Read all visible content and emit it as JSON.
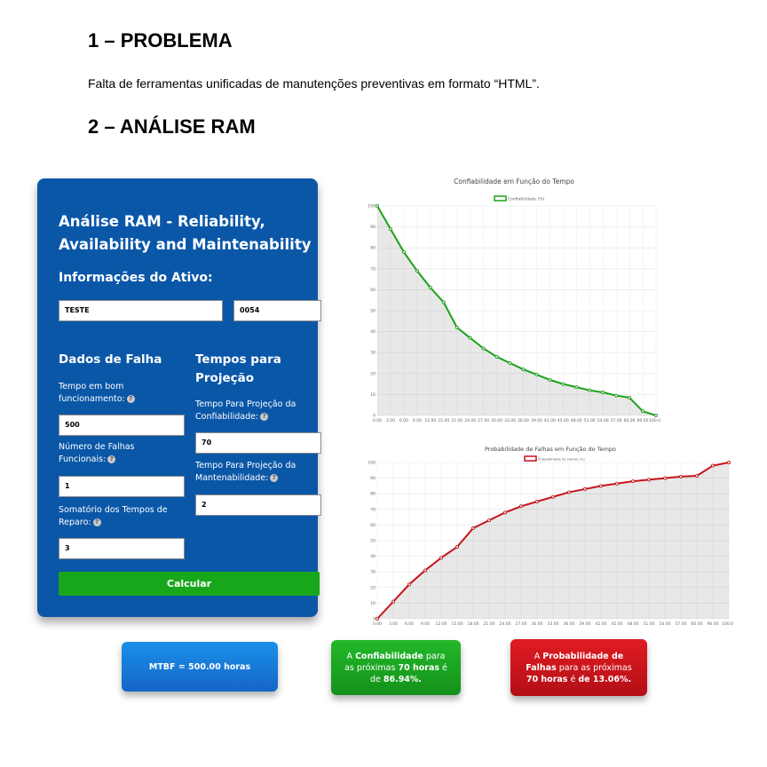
{
  "section1": {
    "heading": "1 – PROBLEMA",
    "text": "Falta de ferramentas unificadas de manutenções preventivas em formato “HTML”."
  },
  "section2": {
    "heading": "2 – ANÁLISE RAM"
  },
  "form": {
    "title": "Análise RAM - Reliability, Availability and Maintenability",
    "asset_info_title": "Informações do Ativo:",
    "asset_name": "TESTE",
    "asset_code": "0054",
    "failure_data_title": "Dados de Falha",
    "uptime_label": "Tempo em bom funcionamento:",
    "uptime_value": "500",
    "failures_label": "Número de Falhas Funcionais:",
    "failures_value": "1",
    "repair_sum_label": "Somatório dos Tempos de Reparo:",
    "repair_sum_value": "3",
    "projection_title": "Tempos para Projeção",
    "reliability_time_label": "Tempo Para Projeção da Confiabilidade:",
    "reliability_time_value": "70",
    "maintainability_time_label": "Tempo Para Projeção da Mantenabilidade:",
    "maintainability_time_value": "2",
    "calculate_label": "Calcular",
    "help_glyph": "?"
  },
  "results": {
    "mtbf": "MTBF = 500.00 horas",
    "reliability": {
      "prefix": "A ",
      "term": "Confiabilidade",
      "mid": " para as próximas ",
      "hours": "70 horas",
      "is": " é de ",
      "value": "86.94%."
    },
    "failure": {
      "prefix": "A ",
      "term": "Probabilidade de Falhas",
      "mid": " para as próximas ",
      "hours": "70 horas",
      "is": " é ",
      "value": "de 13.06%."
    },
    "colors": {
      "mtbf": "#1677d8",
      "reliability": "#1aa41c",
      "failure": "#c8141b"
    }
  },
  "chart_data": [
    {
      "type": "line",
      "title": "Confiabilidade em Função do Tempo",
      "legend": "Confiabilidade (%)",
      "color": "#1aa11a",
      "x": [
        "0.00",
        "3.00",
        "6.00",
        "9.00",
        "12.00",
        "15.00",
        "21.00",
        "24.00",
        "27.00",
        "30.00",
        "33.00",
        "36.00",
        "39.00",
        "42.00",
        "45.00",
        "48.00",
        "51.00",
        "54.00",
        "57.00",
        "60.00",
        "90.00",
        "100.00"
      ],
      "values": [
        100,
        89,
        78,
        69,
        61,
        54,
        42,
        37,
        32,
        28,
        25,
        22,
        19.5,
        17,
        15,
        13.5,
        12,
        11,
        9.5,
        8.5,
        2,
        0
      ],
      "y_ticks": [
        0,
        10,
        20,
        30,
        40,
        50,
        60,
        70,
        80,
        90,
        100
      ],
      "ylim": [
        0,
        100
      ]
    },
    {
      "type": "line",
      "title": "Probabilidade de Falhas em Função do Tempo",
      "legend": "Probabilidade de Falhas (%)",
      "color": "#c8141b",
      "x": [
        "0.00",
        "3.00",
        "6.00",
        "9.00",
        "12.00",
        "15.00",
        "18.00",
        "21.00",
        "24.00",
        "27.00",
        "30.00",
        "33.00",
        "36.00",
        "39.00",
        "42.00",
        "45.00",
        "48.00",
        "51.00",
        "54.00",
        "57.00",
        "60.00",
        "90.00",
        "100.00"
      ],
      "values": [
        0,
        11,
        22,
        31,
        39,
        46,
        58,
        63,
        68,
        72,
        75,
        78,
        81,
        83,
        85,
        86.5,
        88,
        89,
        90,
        91,
        91.5,
        98,
        100
      ],
      "y_ticks": [
        0,
        10,
        20,
        30,
        40,
        50,
        60,
        70,
        80,
        90,
        100
      ],
      "ylim": [
        0,
        100
      ]
    }
  ]
}
